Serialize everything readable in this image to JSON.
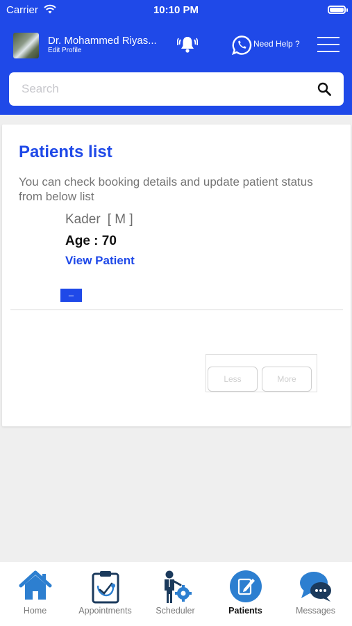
{
  "status_bar": {
    "carrier": "Carrier",
    "time": "10:10 PM"
  },
  "header": {
    "doctor_name": "Dr. Mohammed Riyas...",
    "edit_profile": "Edit Profile",
    "need_help": "Need Help ?"
  },
  "search": {
    "placeholder": "Search",
    "value": ""
  },
  "patients": {
    "title": "Patients list",
    "description": "You can check booking details and update patient status from below list",
    "items": [
      {
        "name": "Kader",
        "gender": "[ M ]",
        "age": "Age : 70",
        "view_label": "View Patient",
        "collapse_label": "–"
      }
    ],
    "pagination": {
      "less_label": "Less",
      "more_label": "More"
    }
  },
  "tabbar": {
    "items": [
      {
        "label": "Home",
        "icon": "home-icon"
      },
      {
        "label": "Appointments",
        "icon": "clipboard-stethoscope-icon"
      },
      {
        "label": "Scheduler",
        "icon": "person-gear-icon"
      },
      {
        "label": "Patients",
        "icon": "edit-note-icon",
        "active": true
      },
      {
        "label": "Messages",
        "icon": "chat-bubbles-icon"
      }
    ]
  },
  "colors": {
    "brand": "#1f49e8",
    "tab_icon_navy": "#1b3a5c",
    "tab_icon_blue": "#2d7fd0"
  }
}
